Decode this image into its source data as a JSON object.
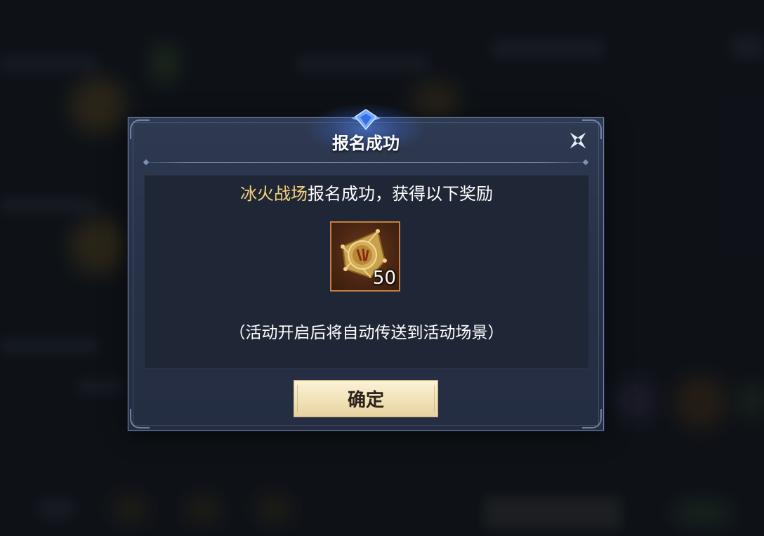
{
  "dialog": {
    "title": "报名成功",
    "message_highlight": "冰火战场",
    "message_rest": "报名成功，获得以下奖励",
    "reward": {
      "icon": "bronze-star-medal-icon",
      "count": "50"
    },
    "note": "（活动开启后将自动传送到活动场景）",
    "confirm_label": "确定",
    "close_icon": "shuriken-close-icon"
  },
  "colors": {
    "highlight": "#f4d27a",
    "dialog_bg": "#283248",
    "button_bg": "#f1e2b8",
    "reward_border": "#c3803f"
  }
}
